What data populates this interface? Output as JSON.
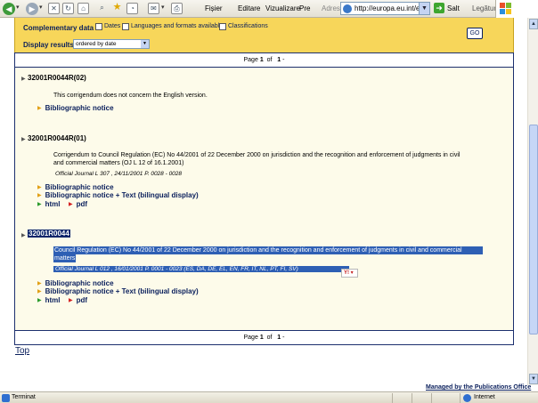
{
  "browser": {
    "menu": [
      "Fișier",
      "Editare",
      "Vizualizare",
      "Pre"
    ],
    "address_label": "Adresă",
    "address_value": "http://europa.eu.int/eur-le",
    "go_label": "Salt",
    "links_label": "Legături",
    "icons": [
      "back-icon",
      "forward-icon",
      "stop-icon",
      "refresh-icon",
      "home-icon",
      "search-icon",
      "favorites-icon",
      "history-icon",
      "mail-icon",
      "print-icon"
    ]
  },
  "criteria": {
    "complementary_label": "Complementary data :",
    "options": [
      {
        "label": "Dates",
        "checked": false
      },
      {
        "label": "Languages and formats available",
        "checked": false
      },
      {
        "label": "Classifications",
        "checked": false
      }
    ],
    "display_label": "Display results :",
    "display_value": "ordered by date",
    "go_button": "GO"
  },
  "pager": {
    "page_label": "Page",
    "current": "1",
    "of_label": "of",
    "total": "1",
    "suffix": "-"
  },
  "results": [
    {
      "id": "32001R0044R(02)",
      "text": "This corrigendum does not concern the English version.",
      "links": [
        "Bibliographic notice"
      ]
    },
    {
      "id": "32001R0044R(01)",
      "text_line1": "Corrigendum to Council Regulation (EC) No 44/2001 of 22 December 2000 on jurisdiction and the recognition and enforcement of judgments in civil",
      "text_line2": "and commercial matters (OJ L 12 of 16.1.2001)",
      "oj_ref": "Official Journal L 307 , 24/11/2001 P. 0028 - 0028",
      "links": [
        "Bibliographic notice",
        "Bibliographic notice + Text (bilingual display)"
      ],
      "formats": [
        "html",
        "pdf"
      ]
    },
    {
      "id": "32001R0044",
      "text_line1": "Council Regulation (EC) No 44/2001 of 22 December 2000 on jurisdiction and the recognition and enforcement of judgments in civil and commercial",
      "text_line2": "matters",
      "oj_ref": "Official Journal L 012 , 16/01/2001 P. 0001 - 0023 (ES, DA, DE, EL, EN, FR, IT, NL, PT, FI, SV)",
      "links": [
        "Bibliographic notice",
        "Bibliographic notice + Text (bilingual display)"
      ],
      "formats": [
        "html",
        "pdf"
      ],
      "widget": "Y!"
    }
  ],
  "top_link": "Top",
  "managed_by": "Managed by the Publications Office",
  "status": {
    "left": "Terminat",
    "zone": "Internet"
  },
  "colors": {
    "criteria_bg": "#f7d65a",
    "results_bg": "#fdfbea",
    "link": "#0a1f5c",
    "selection": "#2e5fb4"
  }
}
